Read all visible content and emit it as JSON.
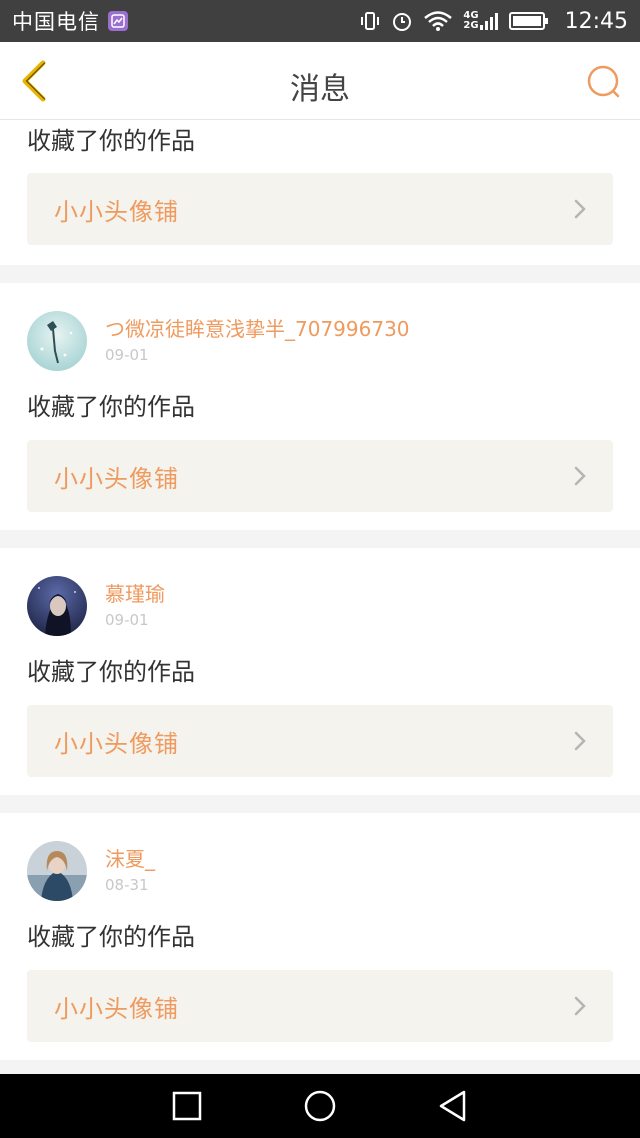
{
  "status_bar": {
    "carrier": "中国电信",
    "network_top": "4G",
    "network_bottom": "2G",
    "time": "12:45"
  },
  "header": {
    "title": "消息",
    "back_icon": "back-chevron-icon",
    "search_icon": "search-icon"
  },
  "colors": {
    "accent": "#ef9a5e",
    "back_yellow": "#e8b400",
    "card_link_bg": "#f4f3ee"
  },
  "notifications": [
    {
      "action": "收藏了你的作品",
      "work_name": "小小头像铺"
    },
    {
      "username": "つ微凉徒眸意浅挚半_707996730",
      "date": "09-01",
      "action": "收藏了你的作品",
      "work_name": "小小头像铺"
    },
    {
      "username": "慕瑾瑜",
      "date": "09-01",
      "action": "收藏了你的作品",
      "work_name": "小小头像铺"
    },
    {
      "username": "沫夏_",
      "date": "08-31",
      "action": "收藏了你的作品",
      "work_name": "小小头像铺"
    }
  ],
  "nav_bar": {
    "recent_icon": "square-recent-apps-icon",
    "home_icon": "circle-home-icon",
    "back_icon": "triangle-back-icon"
  }
}
